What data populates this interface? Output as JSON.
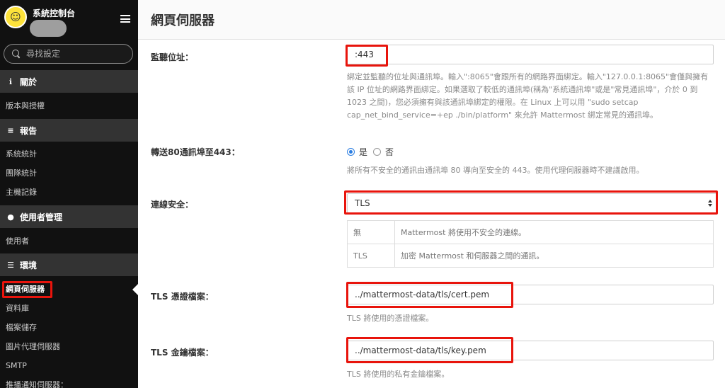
{
  "sidebar": {
    "site_title": "系統控制台",
    "search_placeholder": "尋找設定",
    "sections": [
      {
        "icon": "info-icon",
        "label": "關於",
        "items": [
          "版本與授權"
        ]
      },
      {
        "icon": "bar-chart-icon",
        "label": "報告",
        "items": [
          "系統統計",
          "團隊統計",
          "主機記錄"
        ]
      },
      {
        "icon": "users-icon",
        "label": "使用者管理",
        "items": [
          "使用者"
        ]
      },
      {
        "icon": "server-icon",
        "label": "環境",
        "items": [
          "網頁伺服器",
          "資料庫",
          "檔案儲存",
          "圖片代理伺服器",
          "SMTP",
          "推播通知伺服器："
        ]
      }
    ],
    "active_item": "網頁伺服器"
  },
  "main": {
    "title": "網頁伺服器",
    "listen_address": {
      "label": "監聽位址：",
      "value": ":443",
      "help": "綁定並監聽的位址與通訊埠。輸入\":8065\"會跟所有的網路界面綁定。輸入\"127.0.0.1:8065\"會僅與擁有該 IP 位址的網路界面綁定。如果選取了較低的通訊埠(稱為\"系統通訊埠\"或是\"常見通訊埠\"，介於 0 到 1023 之間)，您必須擁有與該通訊埠綁定的權限。在 Linux 上可以用 \"sudo setcap cap_net_bind_service=+ep ./bin/platform\" 來允許 Mattermost 綁定常見的通訊埠。"
    },
    "forward80": {
      "label": "轉送80通訊埠至443：",
      "options": [
        "是",
        "否"
      ],
      "selected": "是",
      "help": "將所有不安全的通訊由通訊埠 80 導向至安全的 443。使用代理伺服器時不建議啟用。"
    },
    "connection_security": {
      "label": "連線安全：",
      "selected": "TLS",
      "table": [
        {
          "key": "無",
          "desc": "Mattermost 將使用不安全的連線。"
        },
        {
          "key": "TLS",
          "desc": "加密 Mattermost 和伺服器之間的通訊。"
        }
      ]
    },
    "tls_cert": {
      "label": "TLS 憑證檔案：",
      "value": "../mattermost-data/tls/cert.pem",
      "help": "TLS 將使用的憑證檔案。"
    },
    "tls_key": {
      "label": "TLS 金鑰檔案：",
      "value": "../mattermost-data/tls/key.pem",
      "help": "TLS 將使用的私有金鑰檔案。"
    }
  },
  "colors": {
    "sidebar_bg": "#111111",
    "section_bg": "#333333",
    "highlight": "#e8140c",
    "radio_accent": "#2a7de1"
  }
}
